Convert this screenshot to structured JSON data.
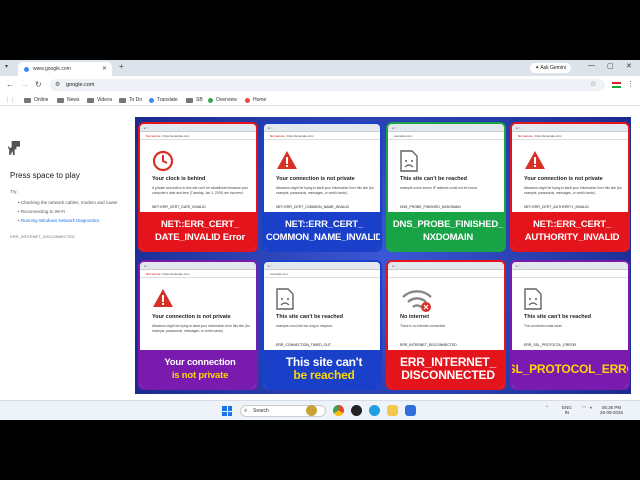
{
  "tab": {
    "title": "www.google.com"
  },
  "toolbar": {
    "url": "google.com",
    "gemini": "Ask Gemini"
  },
  "bookmarks": [
    "Online",
    "News",
    "Videos",
    "To Do",
    "Translate",
    "SB",
    "Overview",
    "Home"
  ],
  "page": {
    "title": "Press space to play",
    "try_label": "Try:",
    "suggestions": [
      "Checking the network cables, modem and router",
      "Reconnecting to Wi-Fi",
      "Running Windows Network Diagnostics"
    ],
    "error_code": "ERR_INTERNET_DISCONNECTED"
  },
  "cards": [
    {
      "icon": "clock-icon",
      "not_secure": "Not secure",
      "url": "https://example.com",
      "heading": "Your clock is behind",
      "desc": "A private connection to this site can't be established because your computer's date and time (Tuesday, Jan 1, 2019) are incorrect.",
      "code": "NET::ERR_CERT_DATE_INVALID",
      "banner": [
        "NET::ERR_CERT_",
        "DATE_INVALID Error"
      ],
      "banner_bg": "#e3141b",
      "banner_fg": "#ffffff"
    },
    {
      "icon": "warning-icon",
      "not_secure": "Not secure",
      "url": "https://example.com",
      "heading": "Your connection is not private",
      "desc": "Attackers might be trying to steal your information from this site (for example, passwords, messages, or credit cards).",
      "code": "NET::ERR_CERT_COMMON_NAME_INVALID",
      "banner": [
        "NET::ERR_CERT_",
        "COMMON_NAME_INVALID"
      ],
      "banner_bg": "#1a3fc9",
      "banner_fg": "#ffffff"
    },
    {
      "icon": "sad-page-icon",
      "not_secure": "",
      "url": "example.com",
      "heading": "This site can't be reached",
      "desc": "example.com's server IP address could not be found.",
      "code": "DNS_PROBE_FINISHED_NXDOMAIN",
      "banner": [
        "DNS_PROBE_FINISHED_",
        "NXDOMAIN"
      ],
      "banner_bg": "#19a347",
      "banner_fg": "#ffffff"
    },
    {
      "icon": "warning-icon",
      "not_secure": "Not secure",
      "url": "https://example.com",
      "heading": "Your connection is not private",
      "desc": "Attackers might be trying to steal your information from this site (for example, passwords, messages, or credit cards).",
      "code": "NET::ERR_CERT_AUTHORITY_INVALID",
      "banner": [
        "NET::ERR_CERT_",
        "AUTHORITY_INVALID"
      ],
      "banner_bg": "#e3141b",
      "banner_fg": "#ffffff"
    },
    {
      "icon": "warning-icon",
      "not_secure": "Not secure",
      "url": "https://example.com",
      "heading": "Your connection is not private",
      "desc": "Attackers might be trying to steal your information from this site (for example, passwords, messages, or credit cards).",
      "code": "",
      "banner": [
        "Your connection",
        "is not private"
      ],
      "banner_bg": "#7a1bb0",
      "banner_fg": "#ffffff",
      "banner_fg2": "#ffd600"
    },
    {
      "icon": "sad-page-icon",
      "not_secure": "",
      "url": "example.com",
      "heading": "This site can't be reached",
      "desc": "example.com took too long to respond.",
      "code": "ERR_CONNECTION_TIMED_OUT",
      "banner": [
        "This site can't",
        "be reached"
      ],
      "banner_bg": "#1a3fc9",
      "banner_fg": "#ffffff",
      "banner_fg2": "#ffd600"
    },
    {
      "icon": "wifi-off-icon",
      "not_secure": "",
      "url": "",
      "heading": "No internet",
      "desc": "There is no internet connection.",
      "code": "ERR_INTERNET_DISCONNECTED",
      "banner": [
        "ERR_INTERNET_",
        "DISCONNECTED"
      ],
      "banner_bg": "#e3141b",
      "banner_fg": "#ffffff"
    },
    {
      "icon": "sad-page-icon",
      "not_secure": "",
      "url": "",
      "heading": "This site can't be reached",
      "desc": "The connection was reset.",
      "code": "ERR_SSL_PROTOCOL_ERROR",
      "banner": [
        "SSL_PROTOCOL_ERROR"
      ],
      "banner_bg": "#7a1bb0",
      "banner_fg": "#ffd600"
    }
  ],
  "taskbar": {
    "search": "Search",
    "lang": "ENG",
    "region": "IN",
    "time": "05:36 PM",
    "date": "26-09-2026"
  }
}
